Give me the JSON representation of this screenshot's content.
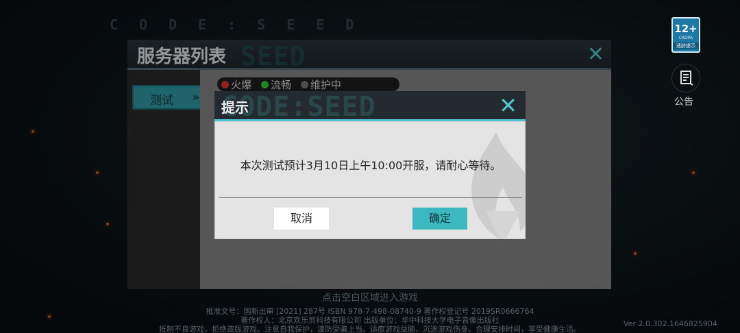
{
  "background": {
    "logo_text": "CODE:SEED"
  },
  "server_list": {
    "title": "服务器列表",
    "watermark": "SEED",
    "close_glyph": "✕",
    "tabs": [
      {
        "label": "测试",
        "arrow": "»"
      }
    ],
    "status_legend": [
      {
        "color": "red",
        "label": "火爆"
      },
      {
        "color": "green",
        "label": "流畅"
      },
      {
        "color": "gray",
        "label": "维护中"
      }
    ]
  },
  "top_right": {
    "age_rating": {
      "number": "12+",
      "org": "CADPA",
      "hint": "适龄提示"
    },
    "notice": {
      "label": "公告",
      "icon": "notice-book-icon"
    }
  },
  "dialog": {
    "title": "提示",
    "watermark": "CODE:SEED",
    "close_glyph": "✕",
    "message": "本次测试预计3月10日上午10:00开服，请耐心等待。",
    "buttons": {
      "cancel": "取消",
      "confirm": "确定"
    }
  },
  "footer": {
    "tap_hint": "点击空白区域进入游戏",
    "legal_lines": [
      "批准文号：国新出审 [2021] 287号 ISBN 978-7-498-08740-9 著作权登记号 2019SR0666764",
      "著作权人：北京欢乐剪科技有限公司 出版单位：华中科技大学电子音像出版社",
      "抵制不良游戏，拒绝盗版游戏。注意自我保护，谨防受骗上当。适度游戏益脑，沉迷游戏伤身。合理安排时间，享受健康生活。"
    ],
    "version": "Ver 2.0.302.1646825904"
  },
  "colors": {
    "accent": "#4fc6cf",
    "dialog_bg": "#e4e4e4",
    "confirm_bg": "#3bb8c0"
  }
}
